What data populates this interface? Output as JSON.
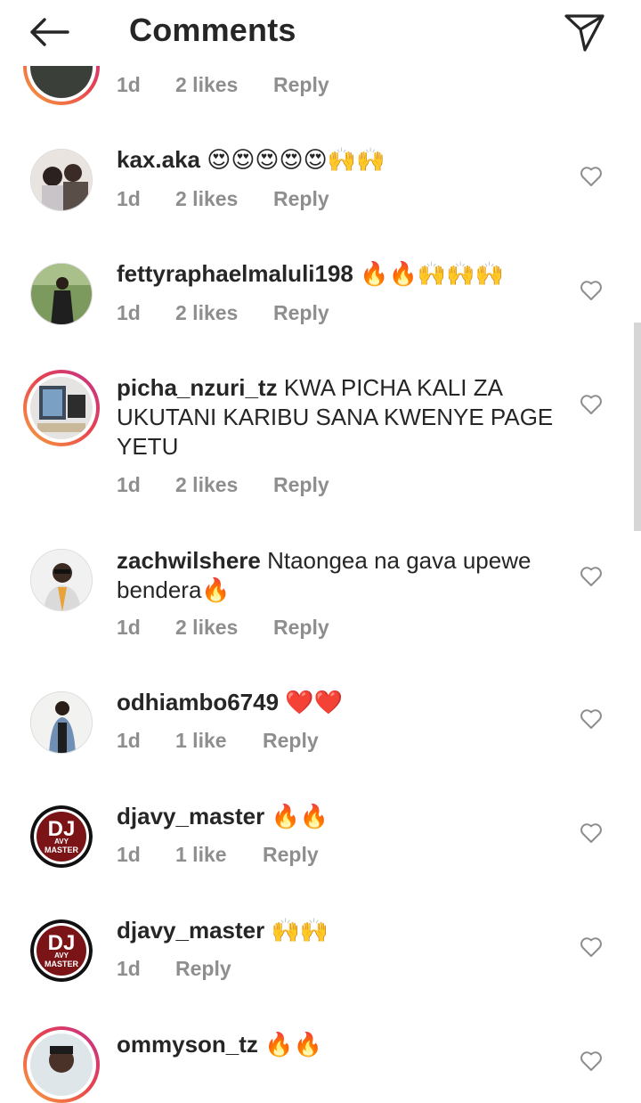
{
  "header": {
    "title": "Comments",
    "back_icon": "arrow-left-icon",
    "send_icon": "paper-plane-icon"
  },
  "partial_comment": {
    "time": "1d",
    "likes": "2 likes",
    "reply": "Reply"
  },
  "comments": [
    {
      "username": "kax.aka",
      "text": " 😍😍😍😍😍🙌🙌",
      "time": "1d",
      "likes": "2 likes",
      "reply": "Reply",
      "avatar": "couple-photo",
      "story": false
    },
    {
      "username": "fettyraphaelmaluli198",
      "text": " 🔥🔥🙌🙌🙌",
      "time": "1d",
      "likes": "2 likes",
      "reply": "Reply",
      "avatar": "woman-outdoors",
      "story": false
    },
    {
      "username": "picha_nzuri_tz",
      "text": " KWA PICHA KALI ZA UKUTANI KARIBU SANA KWENYE PAGE YETU",
      "time": "1d",
      "likes": "2 likes",
      "reply": "Reply",
      "avatar": "framed-photos",
      "story": true
    },
    {
      "username": "zachwilshere",
      "text": " Ntaongea na gava upewe bendera🔥",
      "time": "1d",
      "likes": "2 likes",
      "reply": "Reply",
      "avatar": "man-portrait",
      "story": false
    },
    {
      "username": "odhiambo6749",
      "text": " ❤️❤️",
      "time": "1d",
      "likes": "1 like",
      "reply": "Reply",
      "avatar": "woman-denim",
      "story": false
    },
    {
      "username": "djavy_master",
      "text": " 🔥🔥",
      "time": "1d",
      "likes": "1 like",
      "reply": "Reply",
      "avatar": "dj-logo",
      "story": false
    },
    {
      "username": "djavy_master",
      "text": " 🙌🙌",
      "time": "1d",
      "likes": "",
      "reply": "Reply",
      "avatar": "dj-logo",
      "story": false
    },
    {
      "username": "ommyson_tz",
      "text": " 🔥🔥",
      "time": "",
      "likes": "",
      "reply": "",
      "avatar": "man-story",
      "story": true
    }
  ],
  "dj_logo": {
    "big": "DJ",
    "small": "AVY",
    "label": "MASTER"
  },
  "colors": {
    "text": "#262626",
    "meta": "#8e8e8e",
    "story_ring_start": "#f9a23c",
    "story_ring_end": "#c1318e"
  }
}
